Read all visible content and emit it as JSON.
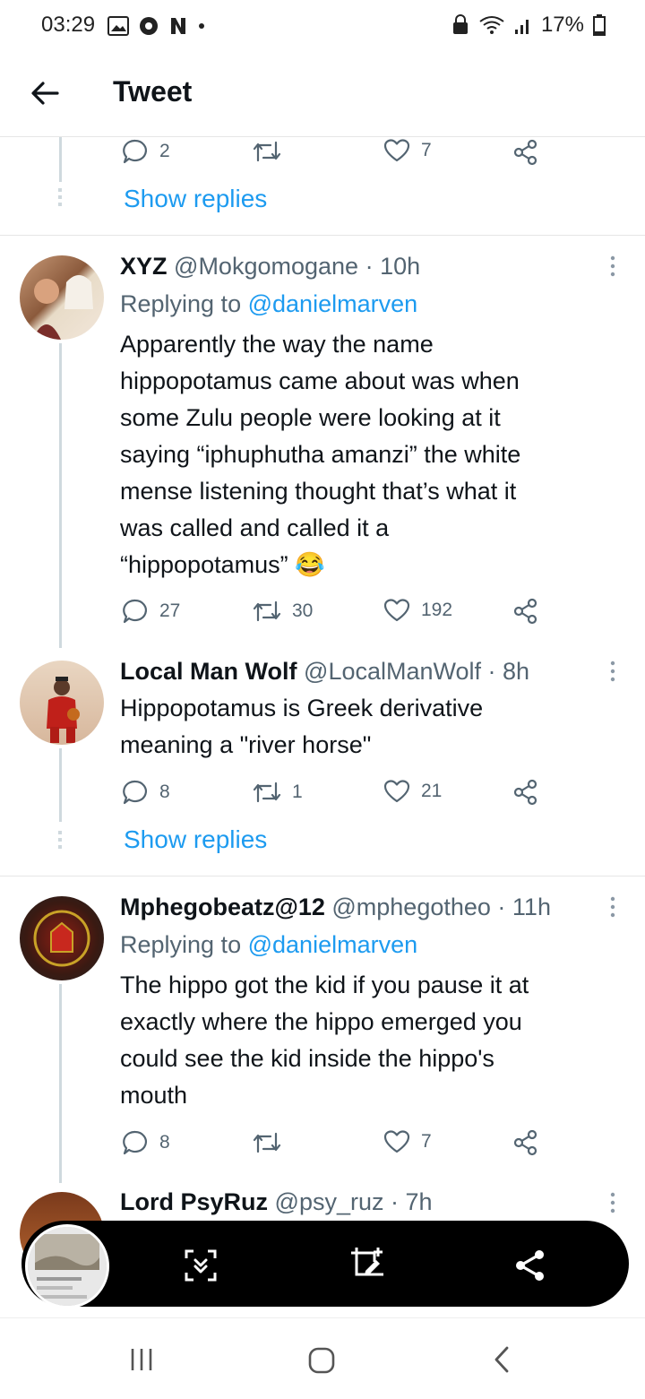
{
  "status": {
    "time": "03:29",
    "battery": "17%"
  },
  "header": {
    "title": "Tweet"
  },
  "top_actions": {
    "replies": "2",
    "retweets": "",
    "likes": "7"
  },
  "show_replies_1": "Show replies",
  "tweets": [
    {
      "name": "XYZ",
      "handle": "@Mokgomogane",
      "time": "· 10h",
      "replying_prefix": "Replying to",
      "replying_handle": "@danielmarven",
      "lines": [
        "Apparently the way the name",
        "hippopotamus came about was when",
        "some Zulu people were looking at it",
        "saying “iphuphutha amanzi” the white",
        "mense listening thought that’s what it",
        "was called and called it a",
        "“hippopotamus” 😂"
      ],
      "replies": "27",
      "retweets": "30",
      "likes": "192"
    },
    {
      "name": "Local Man Wolf",
      "handle": "@LocalManWolf",
      "time": "· 8h",
      "lines": [
        "Hippopotamus is Greek derivative",
        "meaning a \"river horse\""
      ],
      "replies": "8",
      "retweets": "1",
      "likes": "21"
    },
    {
      "name": "Mphegobeatz@12",
      "handle": "@mphegotheo",
      "time": "· 11h",
      "replying_prefix": "Replying to",
      "replying_handle": "@danielmarven",
      "lines": [
        "The hippo got the kid if you pause it at",
        "exactly where the hippo emerged you",
        "could see the kid inside the hippo's",
        "mouth"
      ],
      "replies": "8",
      "retweets": "",
      "likes": "7"
    },
    {
      "name": "Lord PsyRuz",
      "handle": "@psy_ruz",
      "time": "· 7h"
    }
  ],
  "show_replies_2": "Show replies",
  "colors": {
    "accent": "#1d9bf0",
    "muted": "#536471",
    "text": "#0f1419"
  },
  "icons": [
    "back-arrow-icon",
    "reply-icon",
    "retweet-icon",
    "like-icon",
    "share-icon",
    "more-icon",
    "scroll-capture-icon",
    "crop-edit-icon"
  ]
}
